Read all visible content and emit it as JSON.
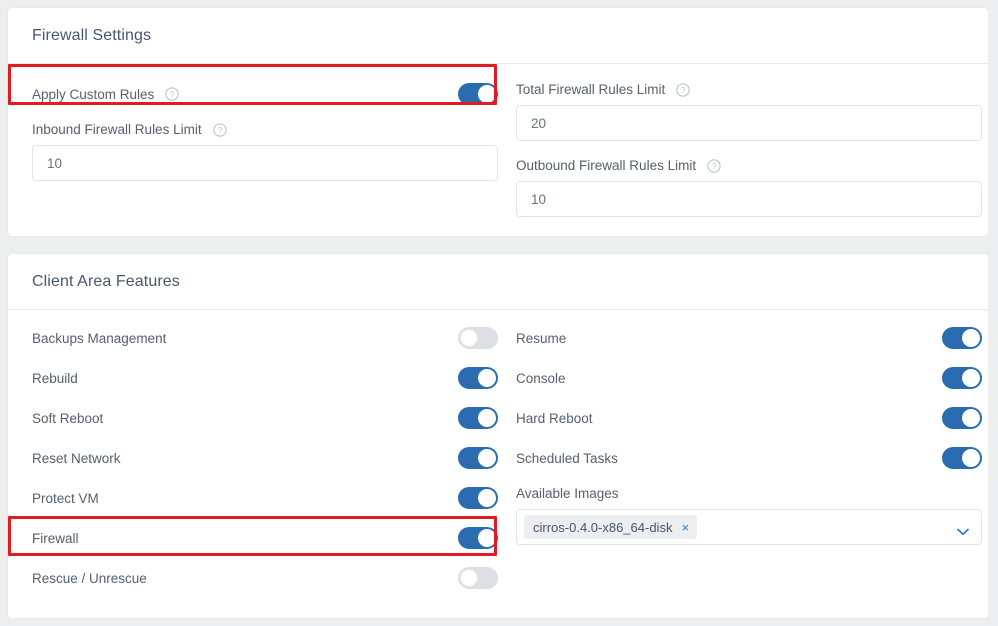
{
  "colors": {
    "accent_blue": "#2b6cb0",
    "toggle_off": "#dcdfe4",
    "highlight_red": "#e11b22",
    "page_bg": "#eceef0",
    "card_bg": "#ffffff",
    "label_text": "#56606e",
    "title_text": "#495671"
  },
  "firewall_settings": {
    "title": "Firewall Settings",
    "apply_custom_rules": {
      "label": "Apply Custom Rules",
      "help_icon": "help-circle-icon",
      "state": "on",
      "highlighted": true
    },
    "inbound_limit": {
      "label": "Inbound Firewall Rules Limit",
      "help_icon": "help-circle-icon",
      "value": "10"
    },
    "total_limit": {
      "label": "Total Firewall Rules Limit",
      "help_icon": "help-circle-icon",
      "value": "20"
    },
    "outbound_limit": {
      "label": "Outbound Firewall Rules Limit",
      "help_icon": "help-circle-icon",
      "value": "10"
    }
  },
  "client_area_features": {
    "title": "Client Area Features",
    "left_toggles": [
      {
        "label": "Backups Management",
        "state": "off"
      },
      {
        "label": "Rebuild",
        "state": "on"
      },
      {
        "label": "Soft Reboot",
        "state": "on"
      },
      {
        "label": "Reset Network",
        "state": "on"
      },
      {
        "label": "Protect VM",
        "state": "on"
      },
      {
        "label": "Firewall",
        "state": "on"
      },
      {
        "label": "Rescue / Unrescue",
        "state": "off"
      }
    ],
    "right_toggles": [
      {
        "label": "Resume",
        "state": "on"
      },
      {
        "label": "Console",
        "state": "on"
      },
      {
        "label": "Hard Reboot",
        "state": "on"
      },
      {
        "label": "Scheduled Tasks",
        "state": "on"
      }
    ],
    "available_images": {
      "label": "Available Images",
      "selected": [
        "cirros-0.4.0-x86_64-disk"
      ],
      "remove_glyph": "×",
      "caret_icon": "chevron-down-icon"
    }
  }
}
